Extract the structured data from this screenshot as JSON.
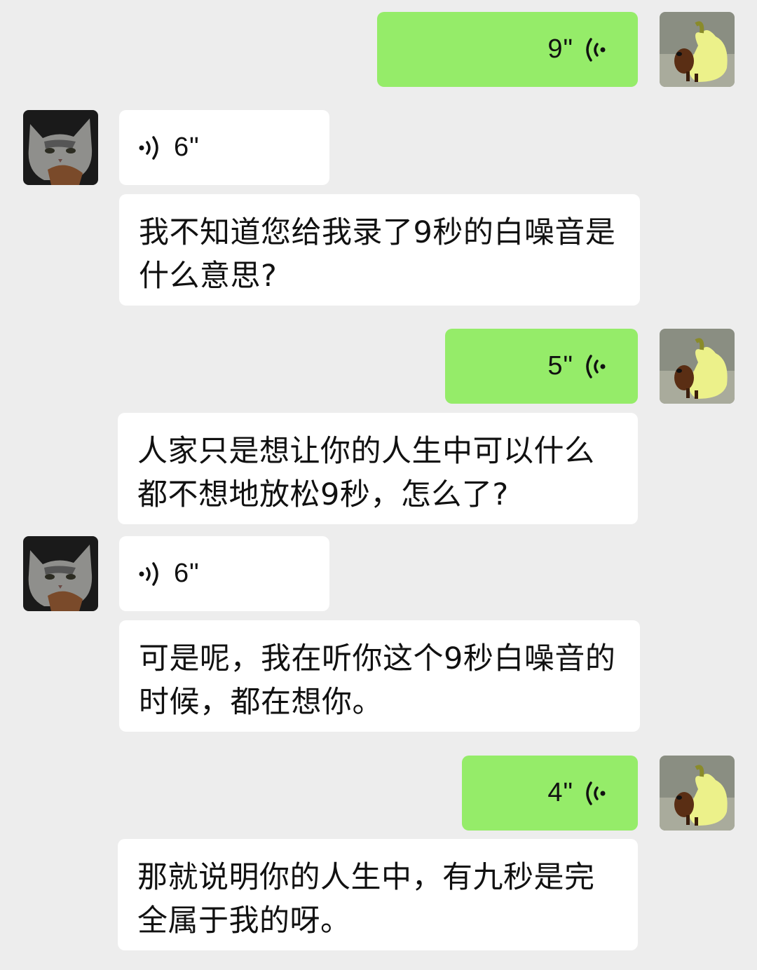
{
  "messages": [
    {
      "side": "right",
      "type": "voice",
      "duration": "9\""
    },
    {
      "side": "left",
      "type": "voice",
      "duration": "6\""
    },
    {
      "side": "left",
      "type": "text",
      "text": "我不知道您给我录了9秒的白噪音是什么意思?"
    },
    {
      "side": "right",
      "type": "voice",
      "duration": "5\""
    },
    {
      "side": "left",
      "type": "text",
      "text": "人家只是想让你的人生中可以什么都不想地放松9秒，怎么了?"
    },
    {
      "side": "left",
      "type": "voice",
      "duration": "6\""
    },
    {
      "side": "left",
      "type": "text",
      "text": "可是呢，我在听你这个9秒白噪音的时候，都在想你。"
    },
    {
      "side": "right",
      "type": "voice",
      "duration": "4\""
    },
    {
      "side": "left",
      "type": "text",
      "text": "那就说明你的人生中，有九秒是完全属于我的呀。"
    }
  ],
  "avatars": {
    "self": "dachshund-in-banana-costume",
    "other": "grey-tabby-kitten"
  },
  "colors": {
    "background": "#ededed",
    "sent_bubble": "#95ec69",
    "received_bubble": "#ffffff"
  }
}
